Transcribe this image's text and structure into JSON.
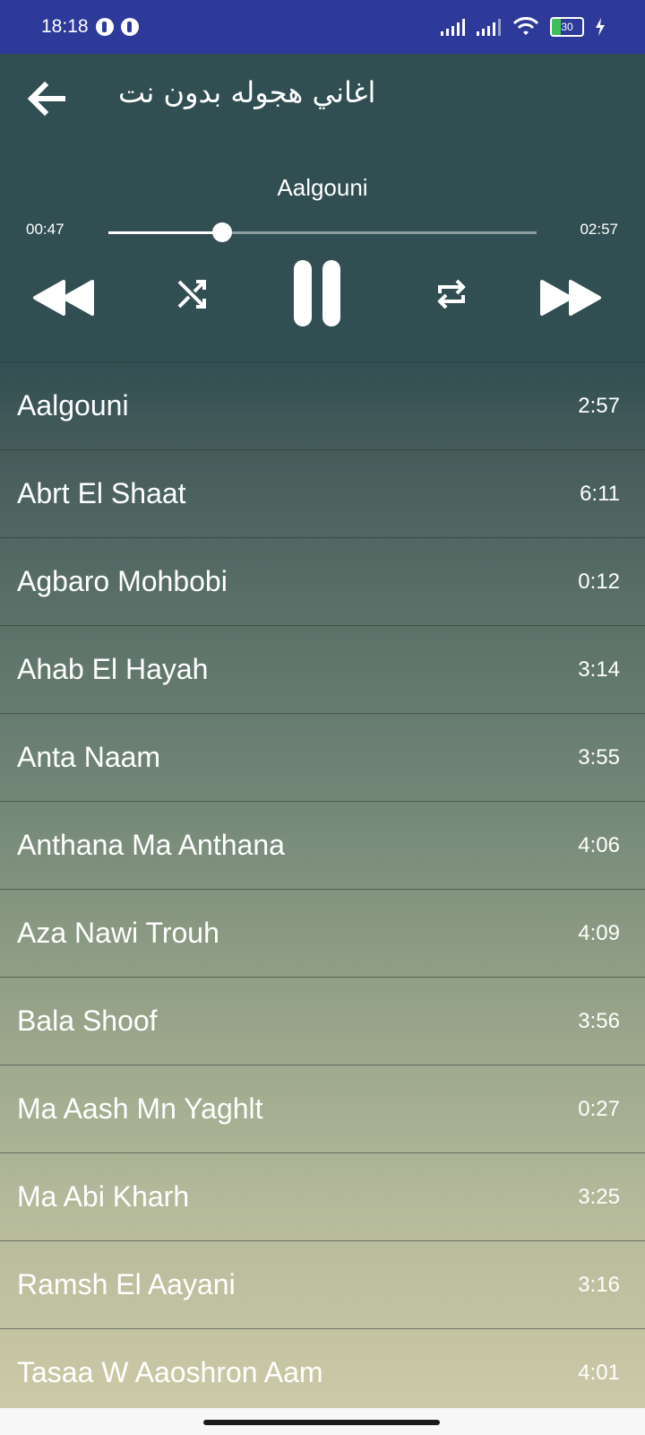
{
  "status_bar": {
    "time": "18:18",
    "battery_level": "30",
    "battery_fraction": 0.3,
    "icons": [
      "notification-icon",
      "notification-icon",
      "signal-icon",
      "signal-icon",
      "wifi-icon",
      "battery-icon",
      "charging-icon"
    ]
  },
  "header": {
    "title": "اغاني هجوله بدون نت",
    "back_icon": "arrow-left-icon"
  },
  "player": {
    "now_playing": "Aalgouni",
    "current_time": "00:47",
    "total_time": "02:57",
    "progress": 0.265,
    "controls": [
      "rewind-icon",
      "shuffle-icon",
      "pause-icon",
      "repeat-icon",
      "fast-forward-icon"
    ]
  },
  "playlist": [
    {
      "title": "Aalgouni",
      "duration": "2:57"
    },
    {
      "title": "Abrt El Shaat",
      "duration": "6:11"
    },
    {
      "title": "Agbaro Mohbobi",
      "duration": "0:12"
    },
    {
      "title": "Ahab El Hayah",
      "duration": "3:14"
    },
    {
      "title": "Anta Naam",
      "duration": "3:55"
    },
    {
      "title": "Anthana Ma Anthana",
      "duration": "4:06"
    },
    {
      "title": "Aza Nawi Trouh",
      "duration": "4:09"
    },
    {
      "title": "Bala Shoof",
      "duration": "3:56"
    },
    {
      "title": "Ma Aash Mn Yaghlt",
      "duration": "0:27"
    },
    {
      "title": "Ma Abi Kharh",
      "duration": "3:25"
    },
    {
      "title": "Ramsh El Aayani",
      "duration": "3:16"
    },
    {
      "title": "Tasaa W Aaoshron Aam",
      "duration": "4:01"
    }
  ],
  "colors": {
    "status_bar": "#2e3a9a",
    "header_bg": "#314e52",
    "list_bottom": "#cdcaa7",
    "accent": "#ffffff"
  }
}
